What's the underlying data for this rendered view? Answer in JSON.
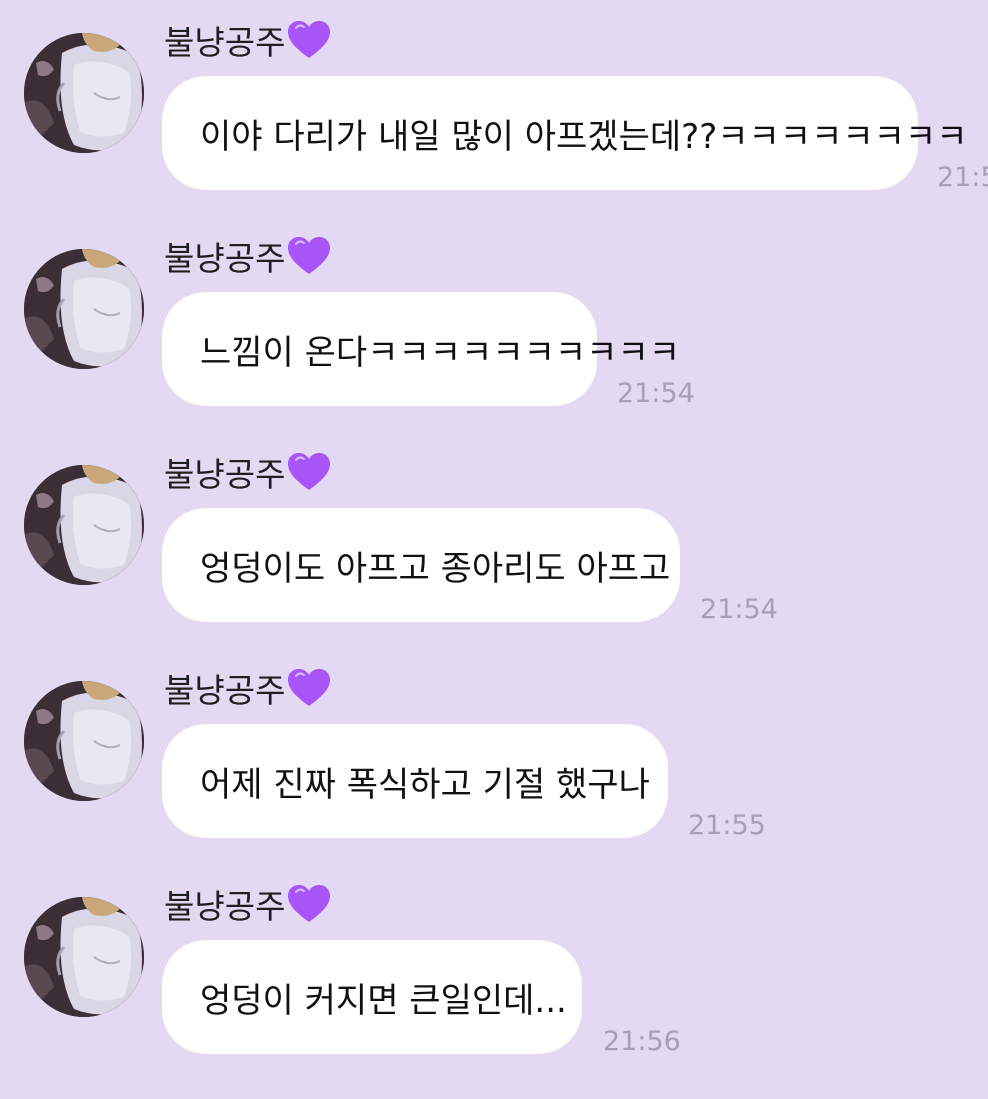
{
  "colors": {
    "background": "#e3d9f2",
    "bubble": "#ffffff",
    "timestamp": "#a79fb3",
    "heart": "#a855f7"
  },
  "messages": [
    {
      "sender": "불냥공주",
      "sender_icon": "purple-heart-icon",
      "text": "이야 다리가 내일 많이 아프겠는데??ㅋㅋㅋㅋㅋㅋㅋㅋ",
      "time": "21:5"
    },
    {
      "sender": "불냥공주",
      "sender_icon": "purple-heart-icon",
      "text": "느낌이 온다ㅋㅋㅋㅋㅋㅋㅋㅋㅋㅋ",
      "time": "21:54"
    },
    {
      "sender": "불냥공주",
      "sender_icon": "purple-heart-icon",
      "text": "엉덩이도 아프고 종아리도 아프고",
      "time": "21:54"
    },
    {
      "sender": "불냥공주",
      "sender_icon": "purple-heart-icon",
      "text": "어제 진짜 폭식하고 기절 했구나",
      "time": "21:55"
    },
    {
      "sender": "불냥공주",
      "sender_icon": "purple-heart-icon",
      "text": "엉덩이 커지면 큰일인데...",
      "time": "21:56"
    }
  ]
}
